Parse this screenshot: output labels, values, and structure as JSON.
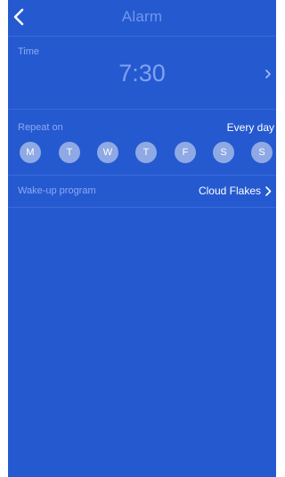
{
  "header": {
    "title": "Alarm"
  },
  "time": {
    "label": "Time",
    "value": "7:30"
  },
  "repeat": {
    "label": "Repeat on",
    "value": "Every day",
    "days": [
      "M",
      "T",
      "W",
      "T",
      "F",
      "S",
      "S"
    ]
  },
  "wakeup": {
    "label": "Wake-up program",
    "value": "Cloud Flakes"
  },
  "colors": {
    "background": "#2559d0",
    "day_circle": "#8ea9e4",
    "muted_text": "#8aabf2",
    "time_text": "#7fa2f0"
  },
  "icons": {
    "back": "chevron-left-icon",
    "time_next": "chevron-right-icon",
    "wakeup_next": "chevron-right-icon"
  }
}
